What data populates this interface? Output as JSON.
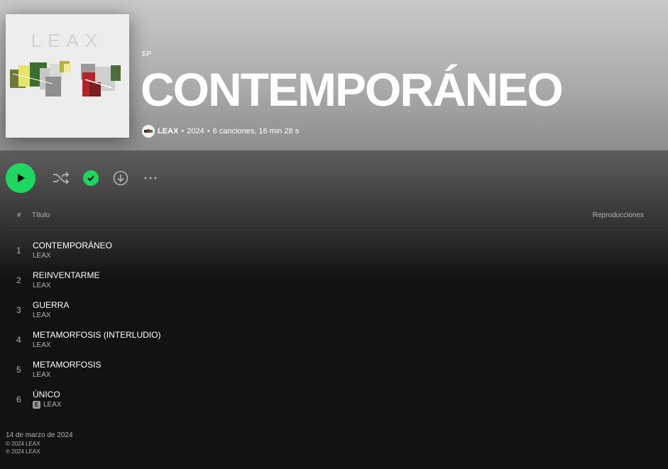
{
  "album": {
    "type": "EP",
    "title": "CONTEMPORÁNEO",
    "cover_text": "LEAX",
    "artist": "LEAX",
    "year": "2024",
    "summary": "6 canciones, 16 min 28 s",
    "separator": "•"
  },
  "actions": {
    "play_icon": "play-icon",
    "shuffle_icon": "shuffle-icon",
    "saved_icon": "check-circle-icon",
    "download_icon": "download-icon",
    "more_icon": "more-horizontal-icon"
  },
  "table": {
    "num_header": "#",
    "title_header": "Título",
    "plays_header": "Reproducciones",
    "tracks": [
      {
        "number": "1",
        "title": "CONTEMPORÁNEO",
        "artist": "LEAX",
        "explicit": false
      },
      {
        "number": "2",
        "title": "REINVENTARME",
        "artist": "LEAX",
        "explicit": false
      },
      {
        "number": "3",
        "title": "GUERRA",
        "artist": "LEAX",
        "explicit": false
      },
      {
        "number": "4",
        "title": "METAMORFOSIS (INTERLUDIO)",
        "artist": "LEAX",
        "explicit": false
      },
      {
        "number": "5",
        "title": "METAMORFOSIS",
        "artist": "LEAX",
        "explicit": false
      },
      {
        "number": "6",
        "title": "ÚNICO",
        "artist": "LEAX",
        "explicit": true,
        "explicit_label": "E"
      }
    ]
  },
  "footer": {
    "release_date": "14 de marzo de 2024",
    "copyright_c": "© 2024 LEAX",
    "copyright_p": "℗ 2024 LEAX"
  },
  "colors": {
    "accent": "#1ed760",
    "background": "#121212",
    "header_gray": "#a9a9a9"
  }
}
